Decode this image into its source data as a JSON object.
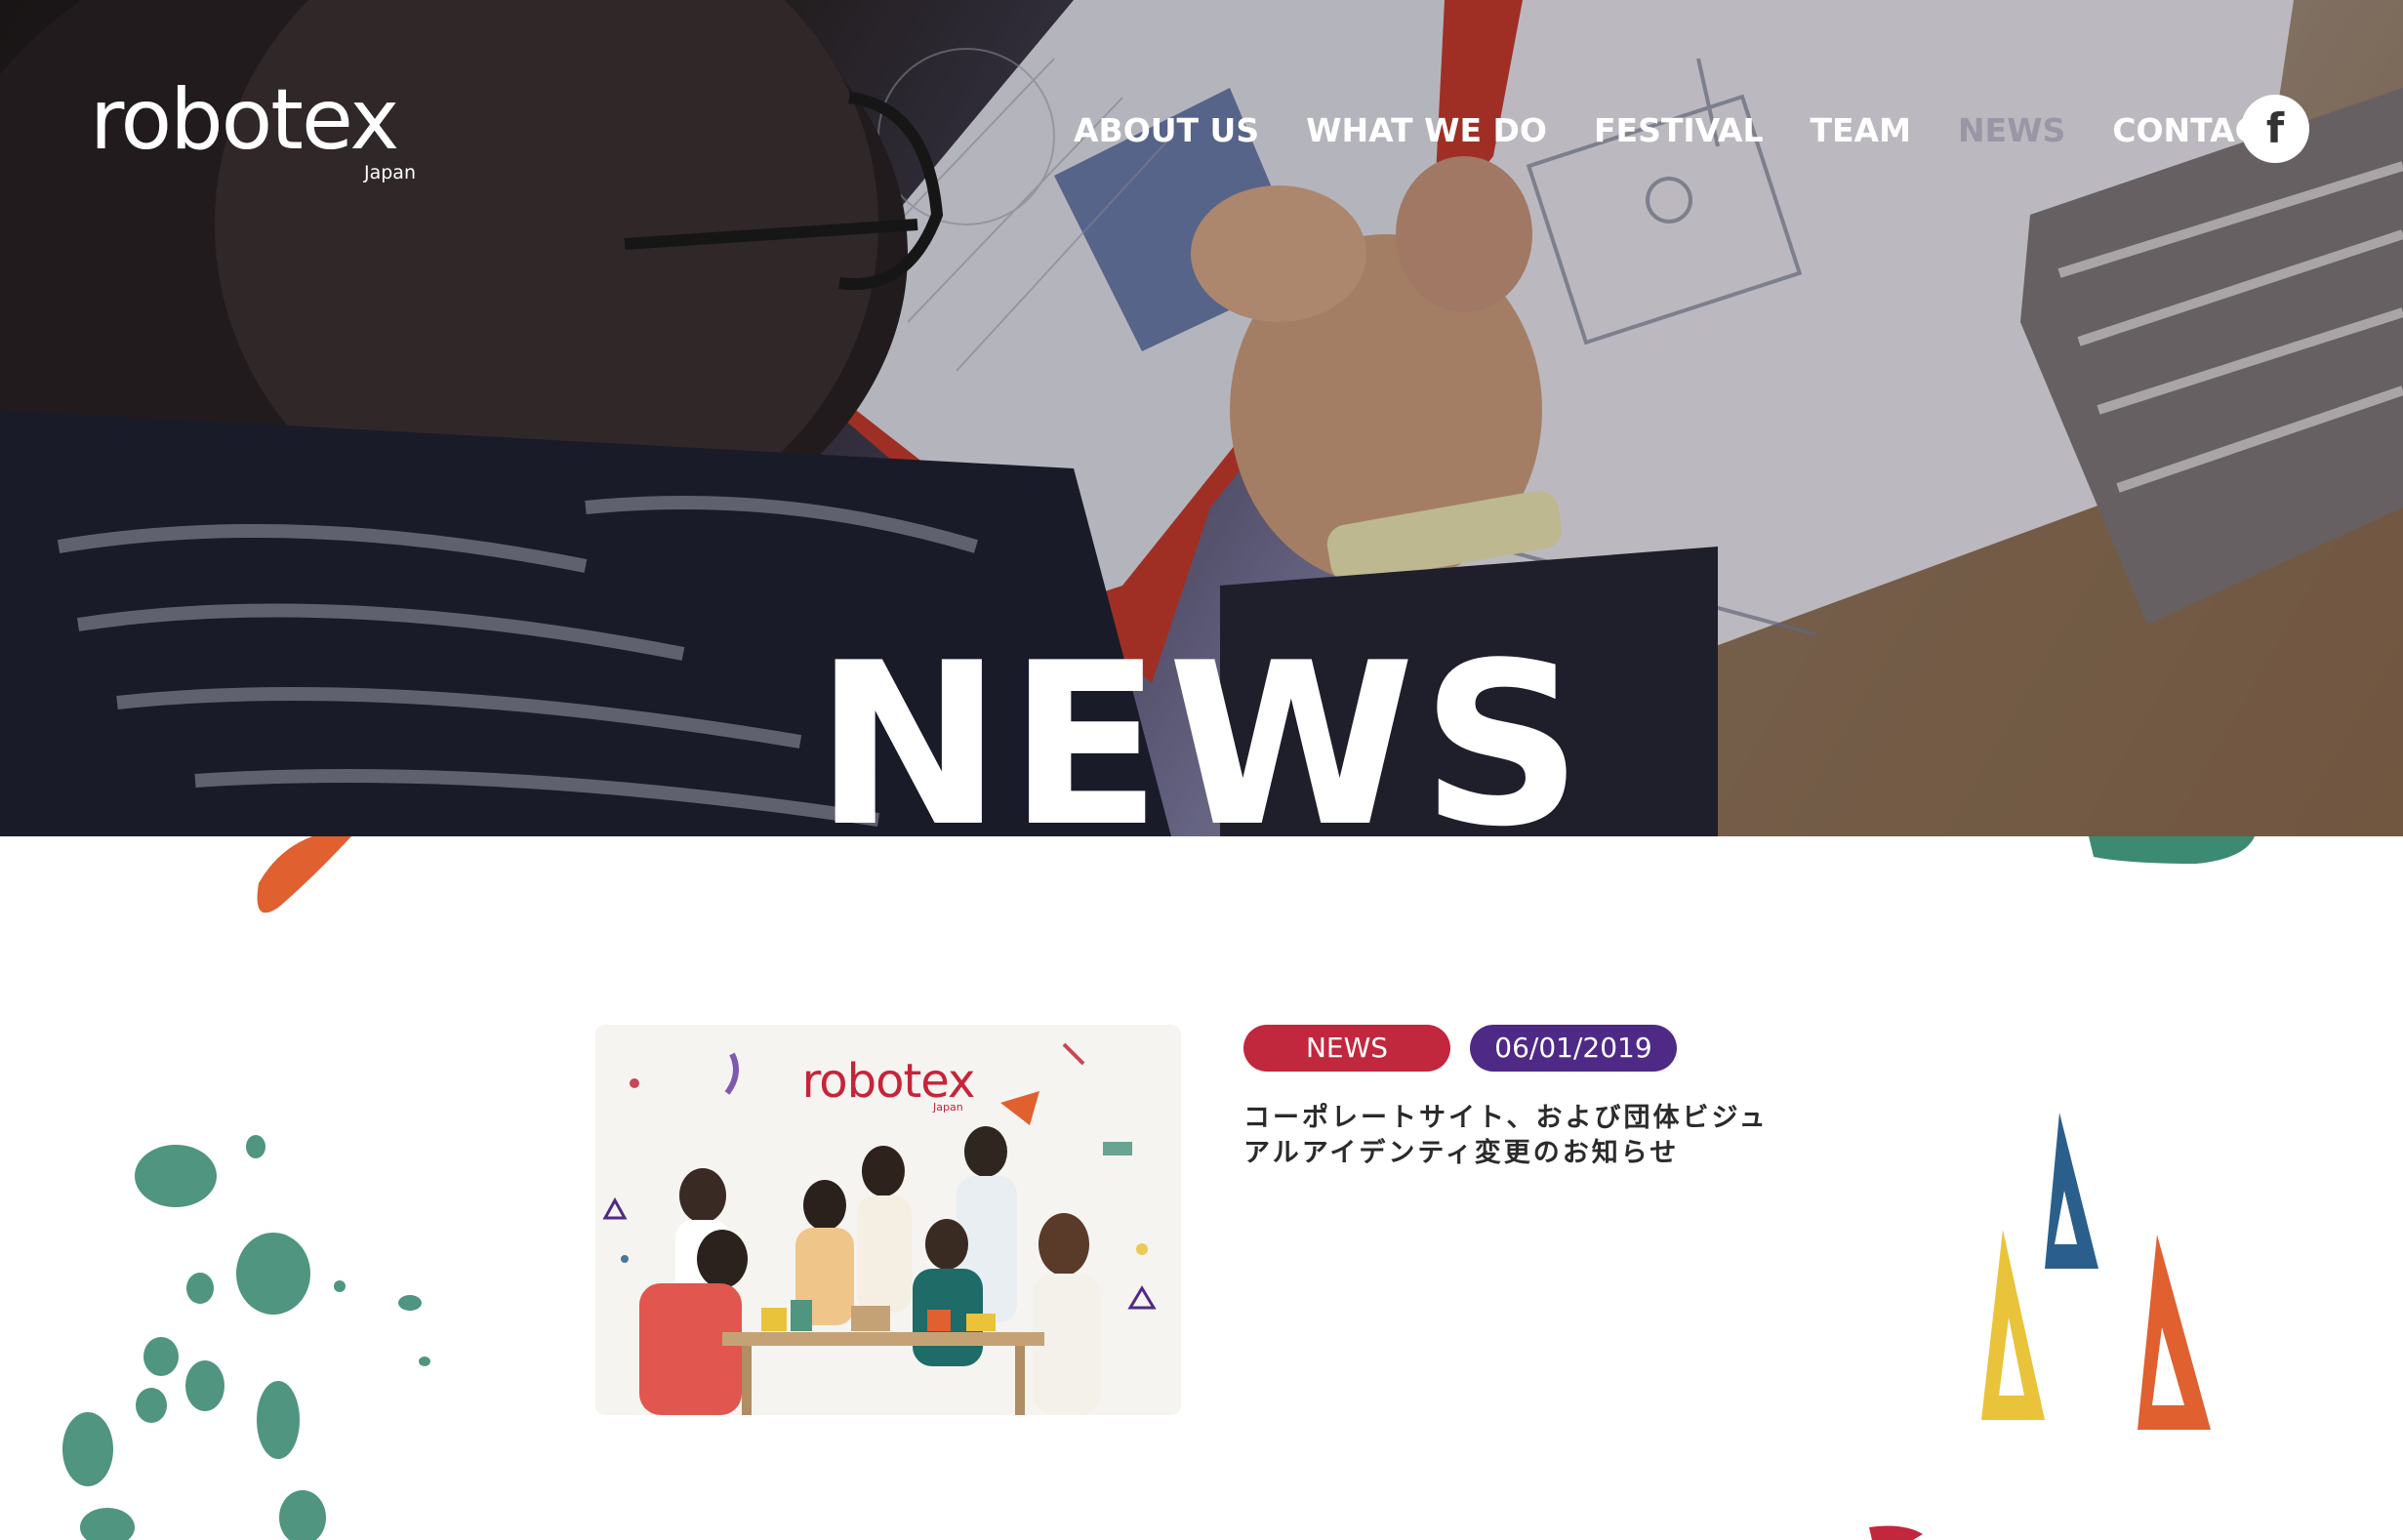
{
  "header": {
    "logo": "robotex",
    "logo_sub": "Japan",
    "nav": {
      "about": "ABOUT US",
      "what": "WHAT WE DO",
      "festival": "FESTIVAL",
      "team": "TEAM",
      "news": "NEWS",
      "contact": "CONTACT"
    },
    "active_nav": "NEWS",
    "social_icon": "facebook-icon"
  },
  "hero": {
    "title": "NEWS"
  },
  "news_items": [
    {
      "image_logo": "robotex",
      "image_logo_sub": "Japan",
      "category": "NEWS",
      "date": "06/01/2019",
      "title": "コーポレートサイト、および団体ビジュアルアイデンティ変更のお知らせ"
    }
  ],
  "colors": {
    "category_tag": "#c1273d",
    "date_tag": "#4e2a86",
    "nav_active": "#9a96a6",
    "teal_splash": "#4f9580",
    "orange": "#e0602f",
    "yellow": "#e9c33a",
    "blue": "#2a5f8c"
  }
}
